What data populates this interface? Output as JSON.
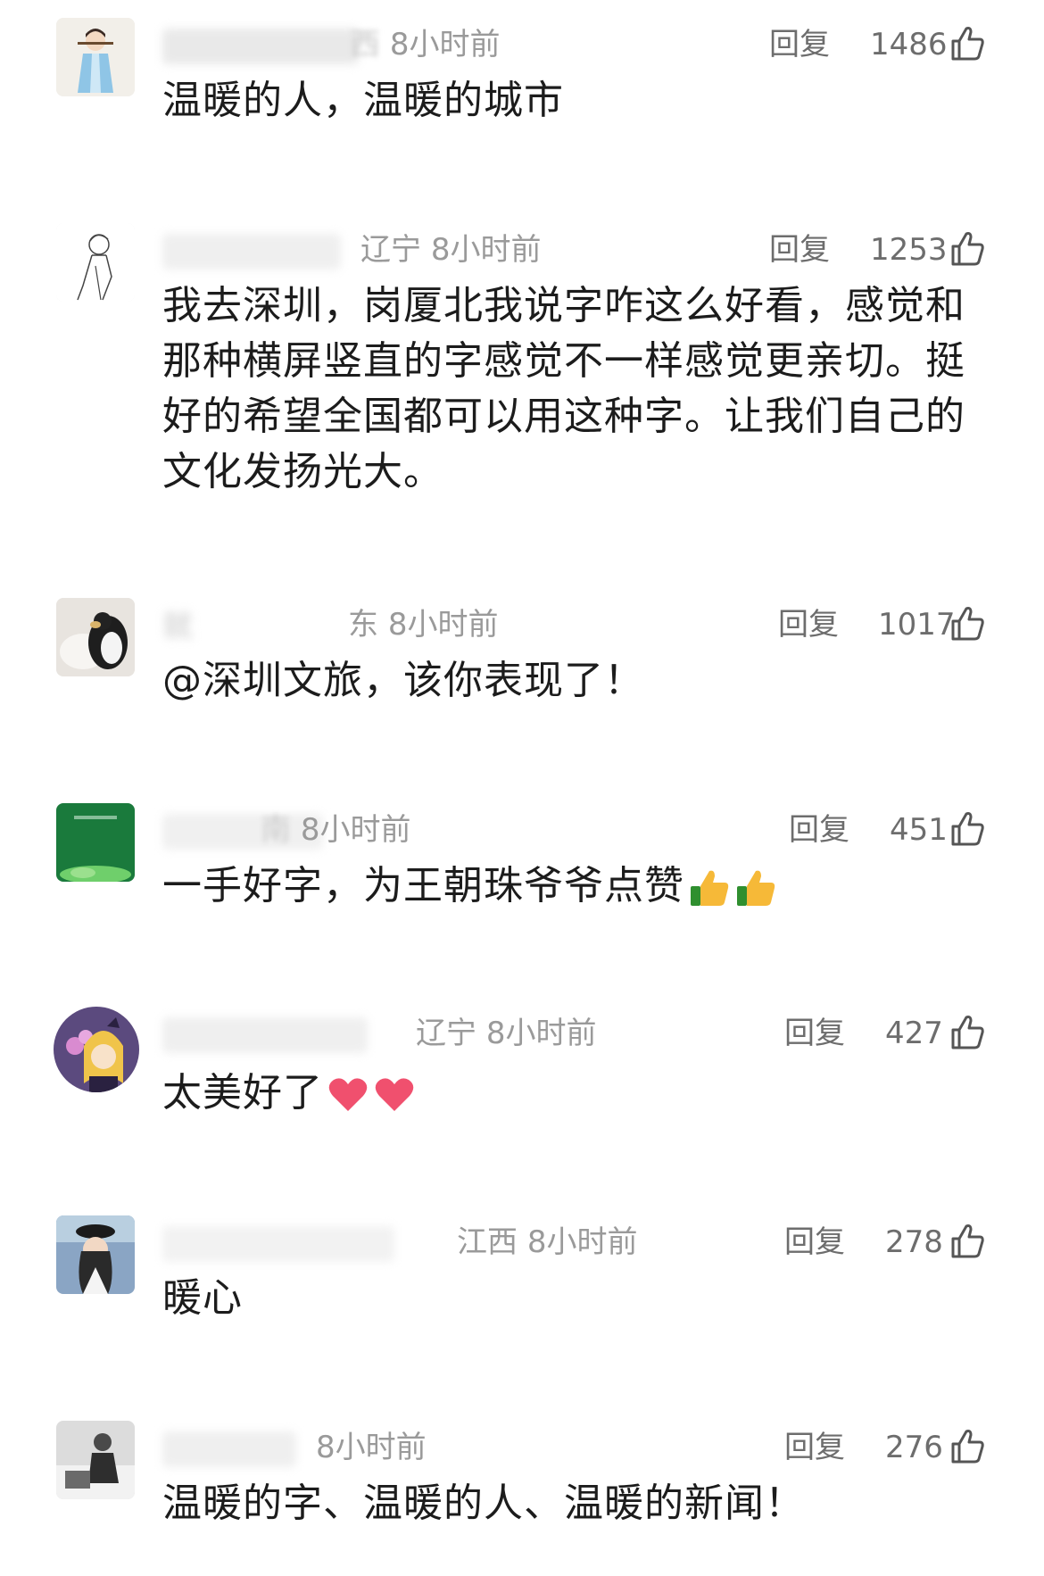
{
  "comments": [
    {
      "location": "西",
      "time": "8小时前",
      "reply_label": "回复",
      "likes": "1486",
      "text": "温暖的人，温暖的城市",
      "emojis": []
    },
    {
      "location": "辽宁",
      "time": "8小时前",
      "reply_label": "回复",
      "likes": "1253",
      "text": "我去深圳，岗厦北我说字咋这么好看，感觉和那种横屏竖直的字感觉不一样感觉更亲切。挺好的希望全国都可以用这种字。让我们自己的文化发扬光大。",
      "emojis": []
    },
    {
      "username": "就",
      "location": "东",
      "time": "8小时前",
      "reply_label": "回复",
      "likes": "1017",
      "text": "@深圳文旅，该你表现了！",
      "emojis": []
    },
    {
      "location": "南",
      "time": "8小时前",
      "reply_label": "回复",
      "likes": "451",
      "text": "一手好字，为王朝珠爷爷点赞",
      "emojis": [
        "thumbs-up-emoji",
        "thumbs-up-emoji"
      ]
    },
    {
      "location": "辽宁",
      "time": "8小时前",
      "reply_label": "回复",
      "likes": "427",
      "text": "太美好了",
      "emojis": [
        "heart-emoji",
        "heart-emoji"
      ]
    },
    {
      "location": "江西",
      "time": "8小时前",
      "reply_label": "回复",
      "likes": "278",
      "text": "暖心",
      "emojis": []
    },
    {
      "location": "",
      "time": "8小时前",
      "reply_label": "回复",
      "likes": "276",
      "text": "温暖的字、温暖的人、温暖的新闻！",
      "emojis": []
    }
  ],
  "colors": {
    "text": "#1c1c1c",
    "meta": "#9a9a9a",
    "action": "#6d6d6d",
    "background": "#ffffff"
  }
}
